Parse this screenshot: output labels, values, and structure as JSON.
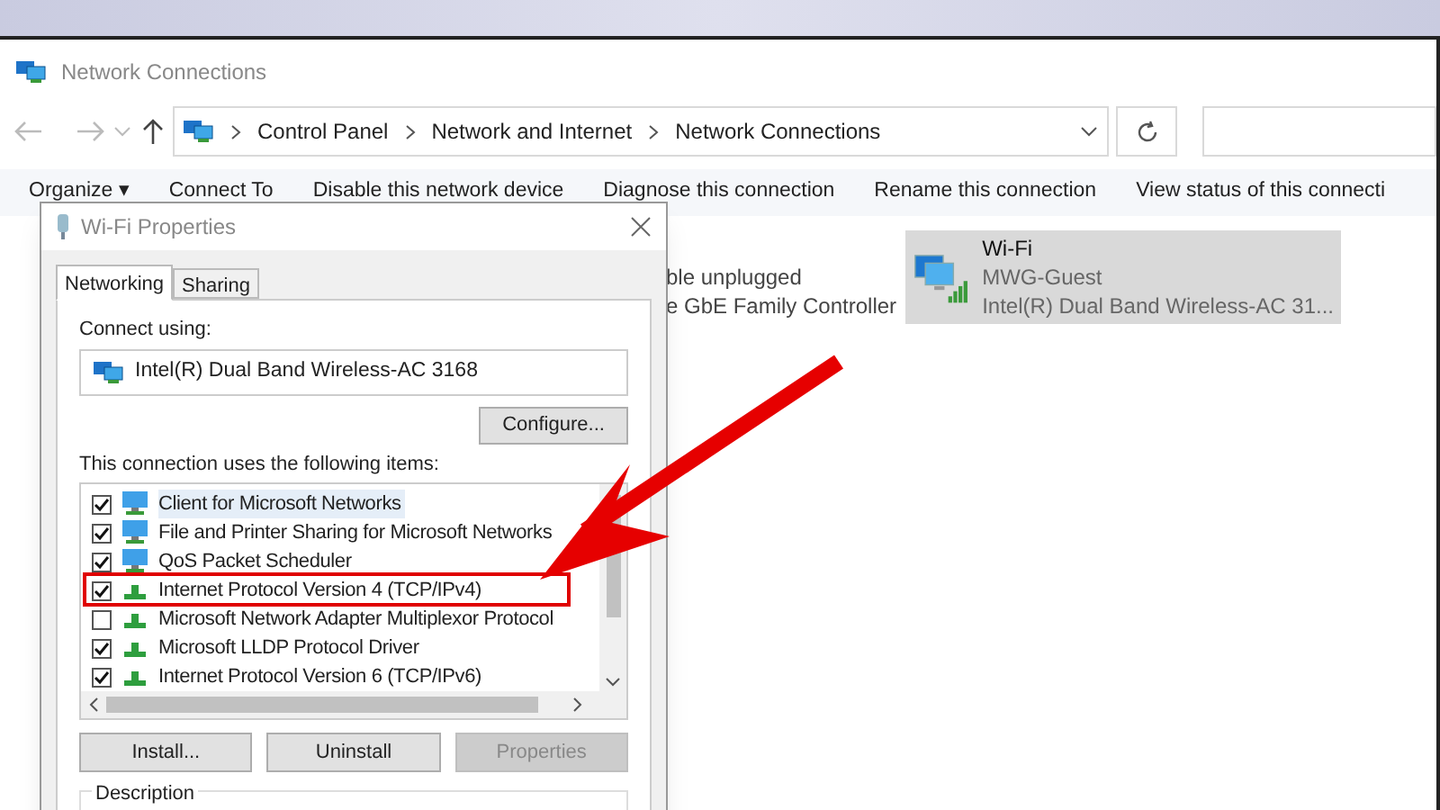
{
  "explorer": {
    "title": "Network Connections",
    "breadcrumb": [
      "Control Panel",
      "Network and Internet",
      "Network Connections"
    ],
    "toolbar": [
      "Organize ▾",
      "Connect To",
      "Disable this network device",
      "Diagnose this connection",
      "Rename this connection",
      "View status of this connecti"
    ],
    "left_adapter_lines": [
      "ble unplugged",
      "e GbE Family Controller"
    ],
    "wifi_tile": {
      "name": "Wi-Fi",
      "network": "MWG-Guest",
      "device": "Intel(R) Dual Band Wireless-AC 31...",
      "selected": true
    }
  },
  "dialog": {
    "title": "Wi-Fi Properties",
    "tabs": [
      {
        "label": "Networking",
        "selected": true
      },
      {
        "label": "Sharing",
        "selected": false
      }
    ],
    "connect_using_label": "Connect using:",
    "adapter": "Intel(R) Dual Band Wireless-AC 3168",
    "configure_button": "Configure...",
    "items_label": "This connection uses the following items:",
    "items": [
      {
        "label": "Client for Microsoft Networks",
        "checked": true,
        "kind": "client",
        "selected": true,
        "highlighted": false
      },
      {
        "label": "File and Printer Sharing for Microsoft Networks",
        "checked": true,
        "kind": "client",
        "selected": false,
        "highlighted": false
      },
      {
        "label": "QoS Packet Scheduler",
        "checked": true,
        "kind": "client",
        "selected": false,
        "highlighted": false
      },
      {
        "label": "Internet Protocol Version 4 (TCP/IPv4)",
        "checked": true,
        "kind": "protocol",
        "selected": false,
        "highlighted": true
      },
      {
        "label": "Microsoft Network Adapter Multiplexor Protocol",
        "checked": false,
        "kind": "protocol",
        "selected": false,
        "highlighted": false
      },
      {
        "label": "Microsoft LLDP Protocol Driver",
        "checked": true,
        "kind": "protocol",
        "selected": false,
        "highlighted": false
      },
      {
        "label": "Internet Protocol Version 6 (TCP/IPv6)",
        "checked": true,
        "kind": "protocol",
        "selected": false,
        "highlighted": false
      }
    ],
    "buttons": [
      {
        "label": "Install...",
        "disabled": false
      },
      {
        "label": "Uninstall",
        "disabled": false
      },
      {
        "label": "Properties",
        "disabled": true
      }
    ],
    "description_label": "Description"
  }
}
